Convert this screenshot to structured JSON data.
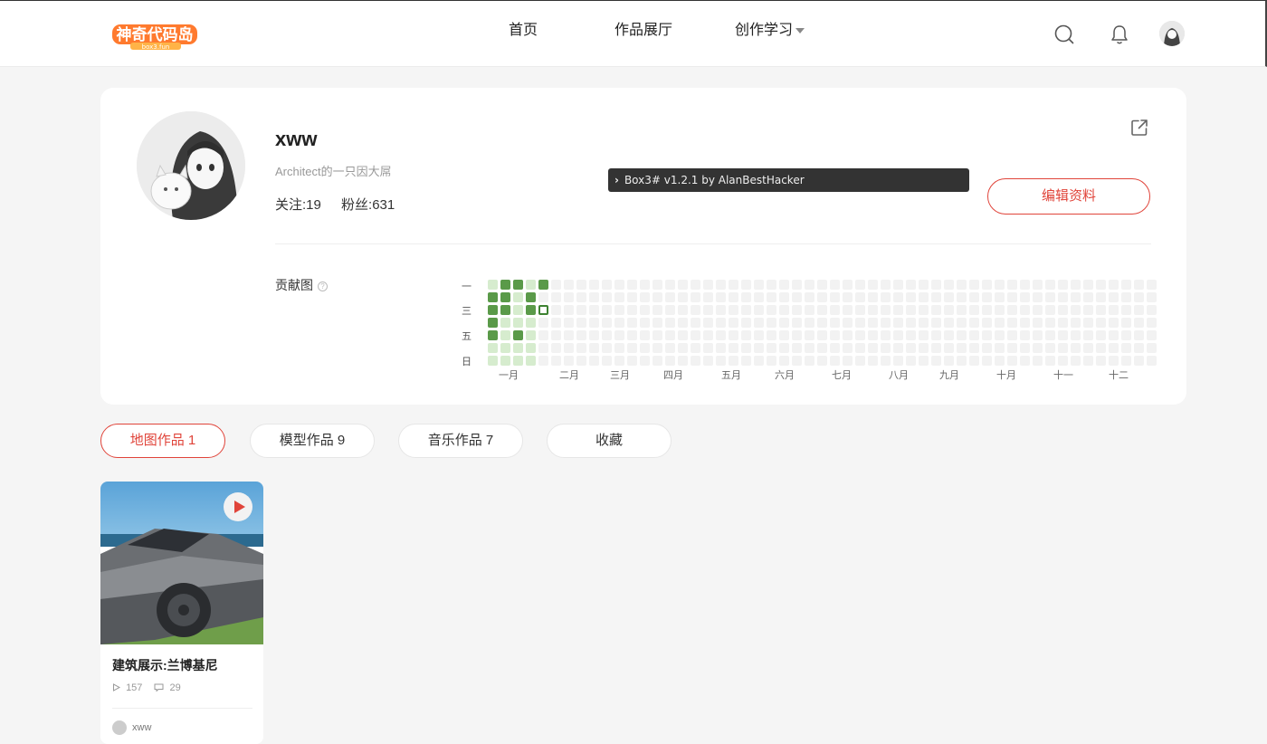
{
  "header": {
    "logo_alt": "神奇代码岛",
    "nav": [
      {
        "label": "首页"
      },
      {
        "label": "作品展厅"
      },
      {
        "label": "创作学习"
      }
    ],
    "icons": [
      "search-icon",
      "bell-icon",
      "user-avatar"
    ]
  },
  "profile": {
    "username": "xww",
    "bio": "Architect的一只因大屌",
    "following_label": "关注:19",
    "followers_label": "粉丝:631",
    "edit_button": "编辑资料",
    "console_text": "Box3# v1.2.1 by AlanBestHacker"
  },
  "contribution": {
    "label": "贡献图",
    "weekdays": [
      "一",
      "三",
      "五",
      "日"
    ],
    "months": [
      "一月",
      "二月",
      "三月",
      "四月",
      "五月",
      "六月",
      "七月",
      "八月",
      "九月",
      "十月",
      "十一",
      "十二"
    ],
    "weeks": 53,
    "active_cells": [
      {
        "week": 0,
        "day": 0,
        "level": 1
      },
      {
        "week": 0,
        "day": 1,
        "level": 3
      },
      {
        "week": 0,
        "day": 2,
        "level": 3
      },
      {
        "week": 0,
        "day": 3,
        "level": 3
      },
      {
        "week": 0,
        "day": 4,
        "level": 3
      },
      {
        "week": 0,
        "day": 5,
        "level": 1
      },
      {
        "week": 0,
        "day": 6,
        "level": 1
      },
      {
        "week": 1,
        "day": 0,
        "level": 3
      },
      {
        "week": 1,
        "day": 1,
        "level": 3
      },
      {
        "week": 1,
        "day": 2,
        "level": 3
      },
      {
        "week": 1,
        "day": 3,
        "level": 1
      },
      {
        "week": 1,
        "day": 4,
        "level": 1
      },
      {
        "week": 1,
        "day": 5,
        "level": 1
      },
      {
        "week": 1,
        "day": 6,
        "level": 1
      },
      {
        "week": 2,
        "day": 0,
        "level": 3
      },
      {
        "week": 2,
        "day": 1,
        "level": 1
      },
      {
        "week": 2,
        "day": 2,
        "level": 1
      },
      {
        "week": 2,
        "day": 3,
        "level": 1
      },
      {
        "week": 2,
        "day": 4,
        "level": 3
      },
      {
        "week": 2,
        "day": 5,
        "level": 1
      },
      {
        "week": 2,
        "day": 6,
        "level": 1
      },
      {
        "week": 3,
        "day": 0,
        "level": 1
      },
      {
        "week": 3,
        "day": 1,
        "level": 3
      },
      {
        "week": 3,
        "day": 2,
        "level": 3
      },
      {
        "week": 3,
        "day": 3,
        "level": 1
      },
      {
        "week": 3,
        "day": 4,
        "level": 1
      },
      {
        "week": 3,
        "day": 5,
        "level": 1
      },
      {
        "week": 3,
        "day": 6,
        "level": 1
      },
      {
        "week": 4,
        "day": 0,
        "level": 3
      },
      {
        "week": 4,
        "day": 2,
        "level": "selected"
      }
    ]
  },
  "tabs": [
    {
      "label": "地图作品 1",
      "active": true
    },
    {
      "label": "模型作品 9",
      "active": false
    },
    {
      "label": "音乐作品 7",
      "active": false
    },
    {
      "label": "收藏",
      "active": false
    }
  ],
  "projects": [
    {
      "title": "建筑展示:兰博基尼",
      "views": "157",
      "comments": "29",
      "author": "xww"
    }
  ],
  "colors": {
    "accent": "#e0443a",
    "contrib_high": "#5a9a49",
    "contrib_low": "#d6ecce",
    "contrib_empty": "#f2f2f2"
  }
}
